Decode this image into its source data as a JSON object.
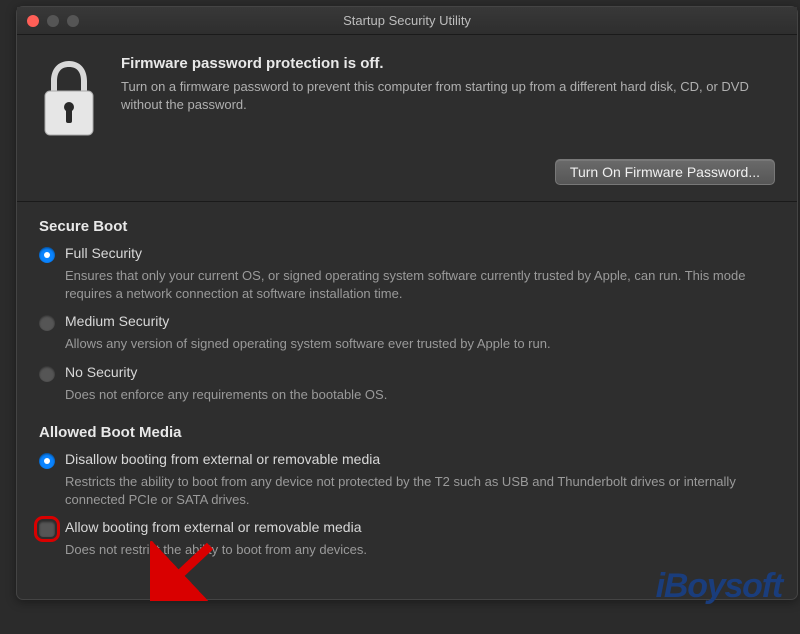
{
  "window": {
    "title": "Startup Security Utility"
  },
  "firmware": {
    "heading": "Firmware password protection is off.",
    "description": "Turn on a firmware password to prevent this computer from starting up from a different hard disk, CD, or DVD without the password.",
    "button_label": "Turn On Firmware Password..."
  },
  "secure_boot": {
    "heading": "Secure Boot",
    "options": [
      {
        "label": "Full Security",
        "desc": "Ensures that only your current OS, or signed operating system software currently trusted by Apple, can run. This mode requires a network connection at software installation time.",
        "selected": true
      },
      {
        "label": "Medium Security",
        "desc": "Allows any version of signed operating system software ever trusted by Apple to run.",
        "selected": false
      },
      {
        "label": "No Security",
        "desc": "Does not enforce any requirements on the bootable OS.",
        "selected": false
      }
    ]
  },
  "boot_media": {
    "heading": "Allowed Boot Media",
    "options": [
      {
        "label": "Disallow booting from external or removable media",
        "desc": "Restricts the ability to boot from any device not protected by the T2 such as USB and Thunderbolt drives or internally connected PCIe or SATA drives.",
        "selected": true
      },
      {
        "label": "Allow booting from external or removable media",
        "desc": "Does not restrict the ability to boot from any devices.",
        "selected": false
      }
    ]
  },
  "watermark": "iBoysoft"
}
